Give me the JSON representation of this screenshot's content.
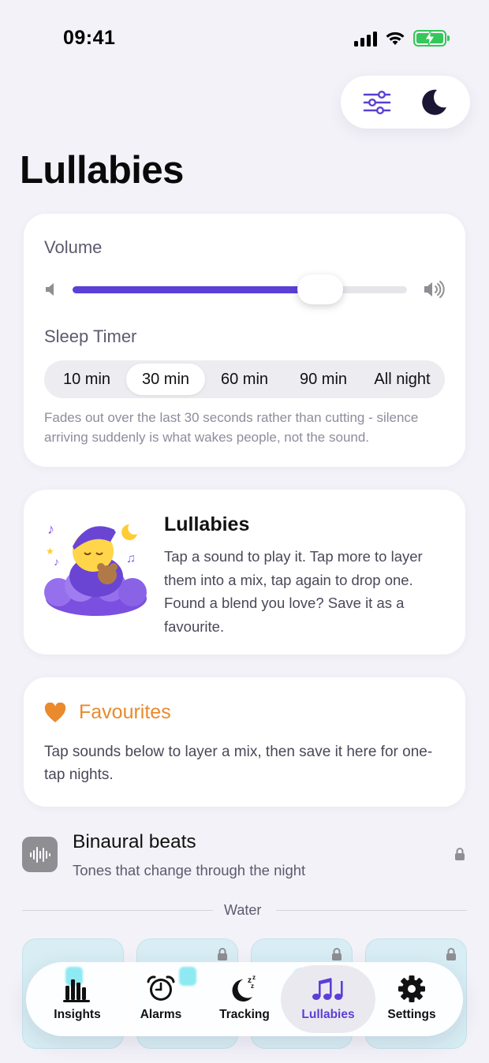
{
  "status_bar": {
    "time": "09:41"
  },
  "page": {
    "title": "Lullabies"
  },
  "volume_card": {
    "volume_label": "Volume",
    "volume_level": 0.74,
    "timer_label": "Sleep Timer",
    "timer_options": [
      "10 min",
      "30 min",
      "60 min",
      "90 min",
      "All night"
    ],
    "selected_timer": "30 min",
    "fade_note": "Fades out over the last 30 seconds rather than cutting - silence arriving suddenly is what wakes people, not the sound."
  },
  "info_card": {
    "title": "Lullabies",
    "text": "Tap a sound to play it. Tap more to layer them into a mix, tap again to drop one. Found a blend you love? Save it as a favourite."
  },
  "favourites": {
    "title": "Favourites",
    "text": "Tap sounds below to layer a mix, then save it here for one-tap nights."
  },
  "binaural": {
    "title": "Binaural beats",
    "subtitle": "Tones that change through the night"
  },
  "water_section": {
    "label": "Water"
  },
  "tabs": [
    {
      "label": "Insights",
      "icon": "bar-chart-icon"
    },
    {
      "label": "Alarms",
      "icon": "alarm-clock-icon"
    },
    {
      "label": "Tracking",
      "icon": "moon-zzz-icon"
    },
    {
      "label": "Lullabies",
      "icon": "music-notes-icon"
    },
    {
      "label": "Settings",
      "icon": "gear-icon"
    }
  ],
  "colors": {
    "accent": "#5b3fd6",
    "favourite": "#ea8a2c",
    "battery": "#34c759"
  }
}
